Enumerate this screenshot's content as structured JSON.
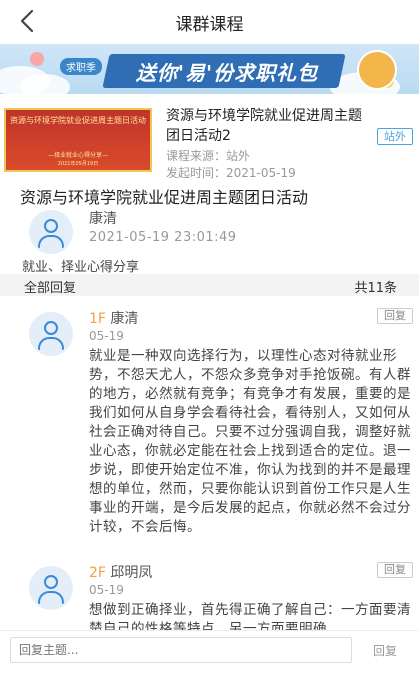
{
  "header": {
    "title": "课群课程"
  },
  "banner": {
    "tag": "求职季",
    "text": "送你'易'份求职礼包"
  },
  "course": {
    "poster_title": "资源与环境学院就业促进周主题日活动",
    "poster_sub": "—择业就业心得分享—",
    "poster_date": "2021年05月19日",
    "title": "资源与环境学院就业促进周主题团日活动2",
    "source": "课程来源：站外",
    "publish_time": "发起时间：2021-05-19",
    "badge": "站外"
  },
  "topic": {
    "title": "资源与环境学院就业促进周主题团日活动",
    "author": "康清",
    "time": "2021-05-19 23:01:49",
    "desc": "就业、择业心得分享"
  },
  "reply_bar": {
    "label": "全部回复",
    "count": "共11条"
  },
  "replies": [
    {
      "floor": "1F",
      "name": "康清",
      "date": "05-19",
      "action": "回复",
      "text": "就业是一种双向选择行为，以理性心态对待就业形势，不怨天尤人，不怨众多竞争对手抢饭碗。有人群的地方，必然就有竞争；有竞争才有发展，重要的是我们如何从自身学会看待社会，看待别人，又如何从社会正确对待自己。只要不过分强调自我，调整好就业心态，你就必定能在社会上找到适合的定位。退一步说，即使开始定位不准，你认为找到的并不是最理想的单位，然而，只要你能认识到首份工作只是人生事业的开端，是今后发展的起点，你就必然不会过分计较，不会后悔。"
    },
    {
      "floor": "2F",
      "name": "邱明凤",
      "date": "05-19",
      "action": "回复",
      "text": "想做到正确择业，首先得正确了解自己：一方面要清楚自己的性格等特点，另一方面要明确"
    }
  ],
  "footer": {
    "placeholder": "回复主题...",
    "send": "回复"
  }
}
